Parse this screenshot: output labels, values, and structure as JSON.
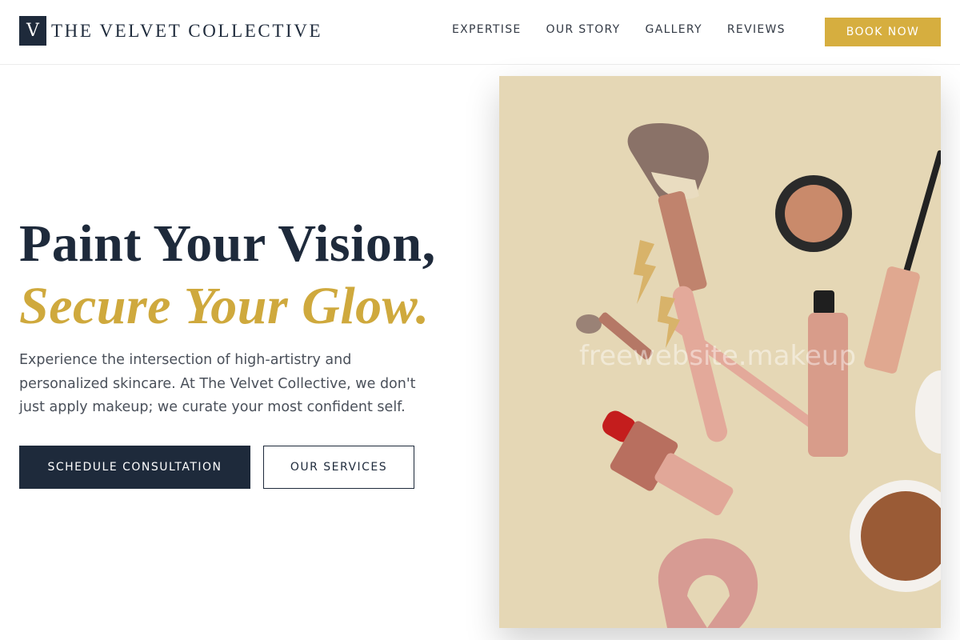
{
  "brand": {
    "mark": "V",
    "name": "THE VELVET COLLECTIVE"
  },
  "nav": {
    "items": [
      {
        "label": "EXPERTISE"
      },
      {
        "label": "OUR STORY"
      },
      {
        "label": "GALLERY"
      },
      {
        "label": "REVIEWS"
      }
    ],
    "cta_label": "BOOK NOW"
  },
  "hero": {
    "title_line1": "Paint Your Vision,",
    "title_line2": "Secure Your Glow.",
    "description": "Experience the intersection of high-artistry and personalized skincare. At The Velvet Collective, we don't just apply makeup; we curate your most confident self.",
    "primary_button": "SCHEDULE CONSULTATION",
    "secondary_button": "OUR SERVICES",
    "image_watermark": "freewebsite.makeup"
  },
  "colors": {
    "navy": "#1e2a3b",
    "gold": "#d6ae3f",
    "image_bg": "#e5d7b5"
  }
}
